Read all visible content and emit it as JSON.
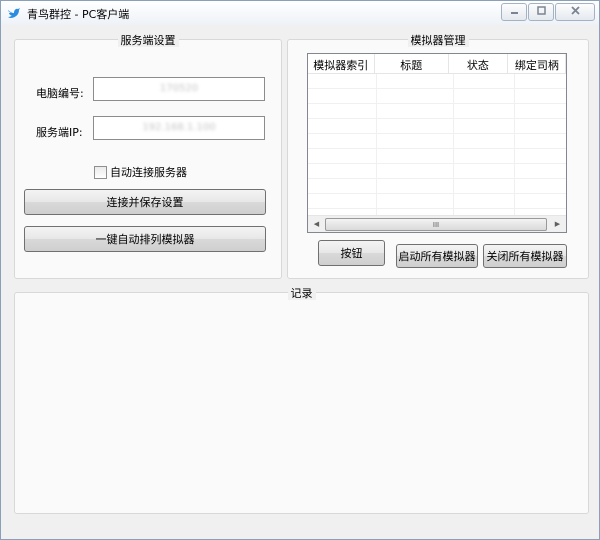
{
  "window": {
    "title": "青鸟群控 - PC客户端"
  },
  "server_settings": {
    "title": "服务端设置",
    "computer_id_label": "电脑编号:",
    "computer_id_value": "170520",
    "server_ip_label": "服务端IP:",
    "server_ip_value": "192.168.1.100",
    "auto_connect_label": "自动连接服务器",
    "auto_connect_checked": false,
    "connect_save_button": "连接并保存设置",
    "arrange_button": "一键自动排列模拟器"
  },
  "emulator_mgmt": {
    "title": "模拟器管理",
    "columns": [
      "模拟器索引",
      "标题",
      "状态",
      "绑定司柄"
    ],
    "rows": [],
    "scroll_thumb_grip": "III",
    "button_label": "按钮",
    "start_all_button": "启动所有模拟器",
    "close_all_button": "关闭所有模拟器"
  },
  "log": {
    "title": "记录"
  }
}
